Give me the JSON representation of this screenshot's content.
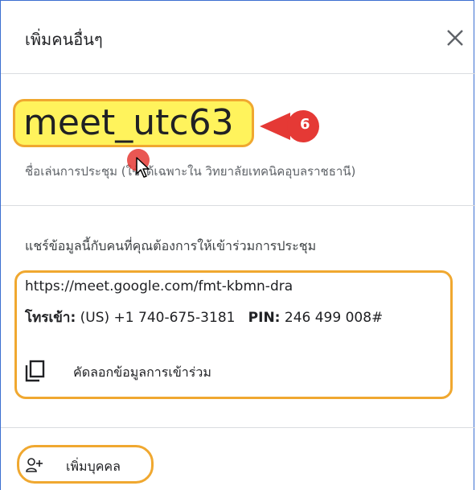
{
  "dialog": {
    "title": "เพิ่มคนอื่นๆ",
    "close_icon": "close-icon"
  },
  "nickname": {
    "value": "meet_utc63",
    "caption": "ชื่อเล่นการประชุม (ใช้ได้เฉพาะใน วิทยาลัยเทคนิคอุบลราชธานี)",
    "step_number": "6"
  },
  "share": {
    "label": "แชร์ข้อมูลนี้กับคนที่คุณต้องการให้เข้าร่วมการประชุม",
    "meet_url": "https://meet.google.com/fmt-kbmn-dra",
    "phone_label": "โทรเข้า:",
    "phone_number": "(US) +1 740-675-3181",
    "pin_label": "PIN:",
    "pin_value": "246 499 008#",
    "copy_label": "คัดลอกข้อมูลการเข้าร่วม",
    "copy_icon": "copy-icon"
  },
  "add_person": {
    "label": "เพิ่มบุคคล",
    "icon": "add-person-icon"
  },
  "colors": {
    "highlight_fill": "#fff35c",
    "annotation_outline": "#f0a830",
    "badge_red": "#e53935",
    "frame_blue": "#3c6fd1"
  }
}
